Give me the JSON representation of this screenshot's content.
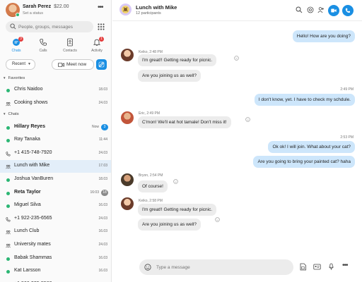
{
  "profile": {
    "name": "Sarah Perez",
    "credit": "$22.00",
    "status": "Set a status"
  },
  "search": {
    "placeholder": "People, groups, messages"
  },
  "nav": [
    {
      "label": "Chats",
      "badge": "3",
      "icon": "chat-icon"
    },
    {
      "label": "Calls",
      "icon": "phone-icon"
    },
    {
      "label": "Contacts",
      "icon": "contacts-icon"
    },
    {
      "label": "Activity",
      "badge": "1",
      "icon": "bell-icon"
    }
  ],
  "filters": {
    "recent": "Recent",
    "meet_now": "Meet now"
  },
  "sections": {
    "favorites": "Favorites",
    "chats": "Chats"
  },
  "favorites": [
    {
      "name": "Chris Naidoo",
      "time": "18.03",
      "kind": "dot"
    },
    {
      "name": "Cooking shows",
      "time": "24.03",
      "kind": "group"
    }
  ],
  "chats": [
    {
      "name": "Hillary Reyes",
      "time": "Now",
      "count": "3",
      "bold": true,
      "kind": "dot"
    },
    {
      "name": "Ray Tanaka",
      "time": "11:44",
      "kind": "dot"
    },
    {
      "name": "+1 415-748-7920",
      "time": "24.03",
      "kind": "phone"
    },
    {
      "name": "Lunch with Mike",
      "time": "17.03",
      "kind": "group",
      "selected": true
    },
    {
      "name": "Joshua VanBuren",
      "time": "18.03",
      "kind": "dot"
    },
    {
      "name": "Reta Taylor",
      "time": "16:03",
      "count": "18",
      "bold": true,
      "kind": "dot",
      "muted": true
    },
    {
      "name": "Miguel Silva",
      "time": "16.03",
      "kind": "dot"
    },
    {
      "name": "+1 922-235-6565",
      "time": "24.03",
      "kind": "phone"
    },
    {
      "name": "Lunch Club",
      "time": "16.03",
      "kind": "group"
    },
    {
      "name": "University mates",
      "time": "24.03",
      "kind": "group"
    },
    {
      "name": "Babak Shammas",
      "time": "16.03",
      "kind": "dot"
    },
    {
      "name": "Kat Larsson",
      "time": "16.03",
      "kind": "dot"
    },
    {
      "name": "+1 866-235-5568",
      "time": "24.03",
      "kind": "phone"
    }
  ],
  "chat": {
    "title": "Lunch with Mike",
    "subtitle": "12 participants"
  },
  "messages": {
    "m1": "Hello! How are you doing?",
    "keiko1_meta": "Keiko, 2:48 PM",
    "m2": "I'm great!! Getting ready for picnic.",
    "m3": "Are you joining us as well?",
    "t1": "2:49 PM",
    "m4": "I don't know, yet. I have to check my schdule.",
    "eric_meta": "Eric, 2:49 PM",
    "m5": "C'mon! We'll eat hot tamale! Don't miss it!",
    "t2": "2:53 PM",
    "m6": "Ok ok! I will join. What about your cat?",
    "m7": "Are you going to bring your painted cat? haha",
    "bryon_meta": "Bryon, 2:54 PM",
    "m8": "Of course!",
    "keiko2_meta": "Keiko, 2:58 PM",
    "m9": "I'm great!! Getting ready for picnic.",
    "m10": "Are you joining us as well?"
  },
  "composer": {
    "placeholder": "Type a message"
  },
  "colors": {
    "accent": "#1a8fe3",
    "online": "#2bb673",
    "badge": "#e43f3f",
    "outgoing": "#cde6fb",
    "incoming": "#ececec"
  }
}
